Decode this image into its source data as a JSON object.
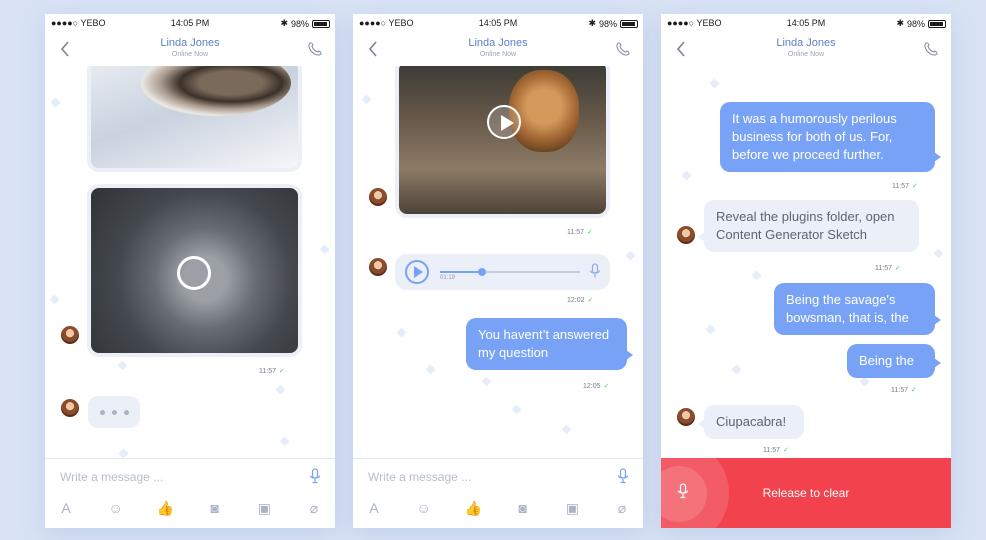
{
  "status": {
    "carrier": "●●●●○ YEBO",
    "time": "14:05 PM",
    "battery": "98%"
  },
  "contact": {
    "name": "Linda Jones",
    "presence": "Online Now"
  },
  "composer": {
    "placeholder": "Write a message ..."
  },
  "toolbar_icons": [
    "font-icon",
    "emoji-icon",
    "thumbs-up-icon",
    "camera-icon",
    "gallery-icon",
    "attachment-icon"
  ],
  "colors": {
    "accent": "#78a2f5",
    "incoming": "#ebeff7",
    "release": "#f2424d",
    "check": "#52c26c"
  },
  "screen1": {
    "video_time": "11:57"
  },
  "screen2": {
    "video_time": "11:57",
    "audio": {
      "elapsed": "01:19",
      "progress": 0.3,
      "time": "12:02"
    },
    "message": "You havent’t answered my question",
    "message_time": "12:05"
  },
  "screen3": {
    "messages": [
      {
        "dir": "out",
        "text": "It was a humorously perilous business for both of us. For, before we proceed further.",
        "time": "11:57"
      },
      {
        "dir": "in",
        "text": "Reveal the plugins folder, open Content Generator Sketch",
        "time": "11:57"
      },
      {
        "dir": "out",
        "text": "Being the savage's bowsman, that is, the"
      },
      {
        "dir": "out",
        "text": "Being the",
        "time": "11:57"
      },
      {
        "dir": "in",
        "text": "Ciupacabra!",
        "time": "11:57"
      }
    ],
    "release_label": "Release to clear"
  }
}
